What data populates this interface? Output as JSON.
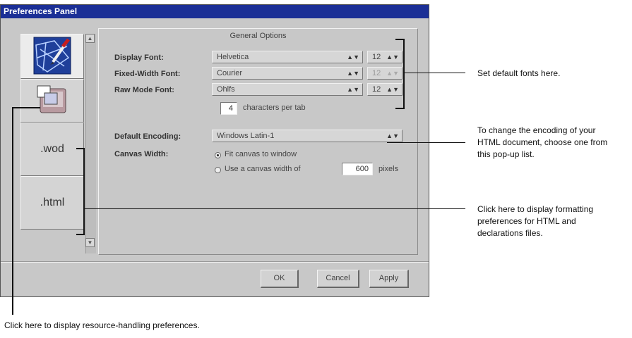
{
  "window": {
    "title": "Preferences Panel",
    "panel_title": "General Options"
  },
  "sidebar": {
    "items": [
      {
        "kind": "icon",
        "icon": "general-options-icon",
        "selected": true
      },
      {
        "kind": "icon",
        "icon": "resource-handling-icon",
        "selected": false
      },
      {
        "kind": "text",
        "label": ".wod",
        "selected": false
      },
      {
        "kind": "text",
        "label": ".html",
        "selected": false
      }
    ]
  },
  "fonts": {
    "display_label": "Display Font:",
    "display_value": "Helvetica",
    "display_size": "12",
    "fixed_label": "Fixed-Width Font:",
    "fixed_value": "Courier",
    "fixed_size": "12",
    "raw_label": "Raw Mode Font:",
    "raw_value": "Ohlfs",
    "raw_size": "12",
    "tab_chars": "4",
    "tab_suffix": "characters per tab"
  },
  "encoding": {
    "label": "Default Encoding:",
    "value": "Windows Latin-1"
  },
  "canvas": {
    "label": "Canvas Width:",
    "option_fit": "Fit canvas to window",
    "option_width": "Use a canvas width of",
    "width_value": "600",
    "units": "pixels",
    "selected": "fit"
  },
  "buttons": {
    "ok": "OK",
    "cancel": "Cancel",
    "apply": "Apply"
  },
  "callouts": {
    "fonts": "Set default fonts here.",
    "encoding_1": "To change the encoding of your",
    "encoding_2": "HTML document, choose one from",
    "encoding_3": "this pop-up list.",
    "html_1": "Click here to display formatting",
    "html_2": "preferences for HTML and",
    "html_3": "declarations files.",
    "resource": "Click here to display resource-handling preferences."
  }
}
